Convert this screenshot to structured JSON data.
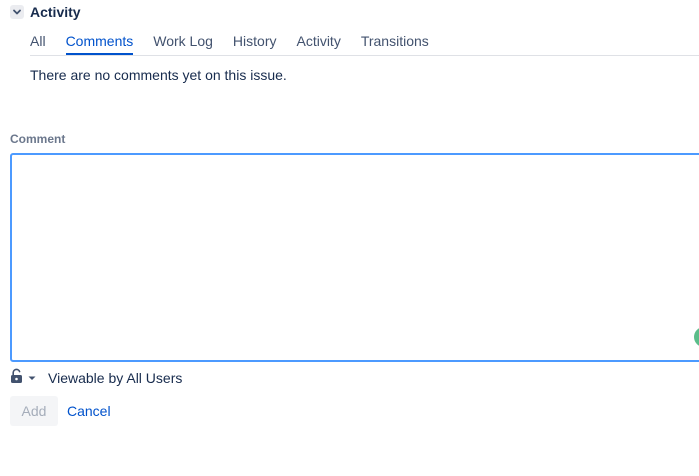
{
  "section": {
    "title": "Activity",
    "toggle_icon": "chevron-down-icon"
  },
  "tabs": [
    {
      "label": "All",
      "active": false
    },
    {
      "label": "Comments",
      "active": true
    },
    {
      "label": "Work Log",
      "active": false
    },
    {
      "label": "History",
      "active": false
    },
    {
      "label": "Activity",
      "active": false
    },
    {
      "label": "Transitions",
      "active": false
    }
  ],
  "empty_message": "There are no comments yet on this issue.",
  "comment": {
    "label": "Comment",
    "value": ""
  },
  "visibility": {
    "icon": "unlock-icon",
    "dropdown_icon": "caret-down-icon",
    "text": "Viewable by All Users"
  },
  "buttons": {
    "add": "Add",
    "cancel": "Cancel"
  },
  "colors": {
    "accent": "#0052cc",
    "focus_border": "#4c9aff",
    "assistant_dot": "#5bbd8a"
  }
}
